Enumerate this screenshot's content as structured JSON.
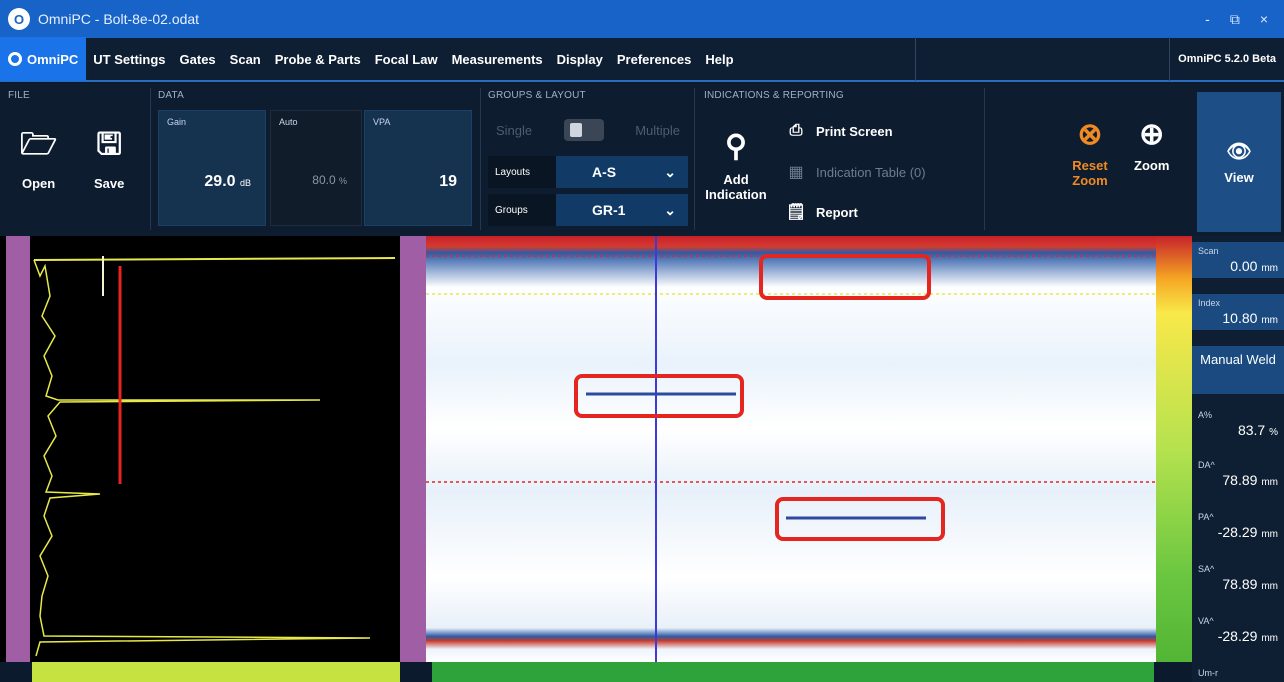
{
  "window": {
    "title": "OmniPC - Bolt-8e-02.odat",
    "minimize": "-",
    "restore": "⧉",
    "close": "×"
  },
  "menu": {
    "brand": "OmniPC",
    "items": [
      "UT Settings",
      "Gates",
      "Scan",
      "Probe & Parts",
      "Focal Law",
      "Measurements",
      "Display",
      "Preferences",
      "Help"
    ],
    "version": "OmniPC 5.2.0 Beta"
  },
  "ribbon": {
    "file": {
      "label": "FILE",
      "open": "Open",
      "save": "Save"
    },
    "data": {
      "label": "DATA",
      "gain": {
        "label": "Gain",
        "value": "29.0",
        "unit": "dB"
      },
      "auto": {
        "label": "Auto",
        "value": "80.0",
        "unit": "%"
      },
      "vpa": {
        "label": "VPA",
        "value": "19"
      }
    },
    "groups_layout": {
      "label": "GROUPS & LAYOUT",
      "single": "Single",
      "multiple": "Multiple",
      "layouts_label": "Layouts",
      "layouts_value": "A-S",
      "groups_label": "Groups",
      "groups_value": "GR-1"
    },
    "indications": {
      "label": "INDICATIONS & REPORTING",
      "add_indication": "Add Indication",
      "print_screen": "Print Screen",
      "indication_table": "Indication Table (0)",
      "report": "Report"
    },
    "view_tools": {
      "reset_zoom": "Reset Zoom",
      "zoom": "Zoom",
      "view": "View"
    }
  },
  "side_panel": {
    "scan": {
      "label": "Scan",
      "value": "0.00",
      "unit": "mm"
    },
    "index": {
      "label": "Index",
      "value": "10.80",
      "unit": "mm"
    },
    "mode": "Manual Weld",
    "a_pct": {
      "label": "A%",
      "value": "83.7",
      "unit": "%"
    },
    "da": {
      "label": "DA^",
      "value": "78.89",
      "unit": "mm"
    },
    "pa": {
      "label": "PA^",
      "value": "-28.29",
      "unit": "mm"
    },
    "sa": {
      "label": "SA^",
      "value": "78.89",
      "unit": "mm"
    },
    "va": {
      "label": "VA^",
      "value": "-28.29",
      "unit": "mm"
    },
    "more": "Um-r"
  },
  "colors": {
    "accent": "#1a73e8",
    "titlebar": "#1763c8",
    "highlight_box": "#e5251f",
    "reset_zoom": "#f08a24"
  }
}
